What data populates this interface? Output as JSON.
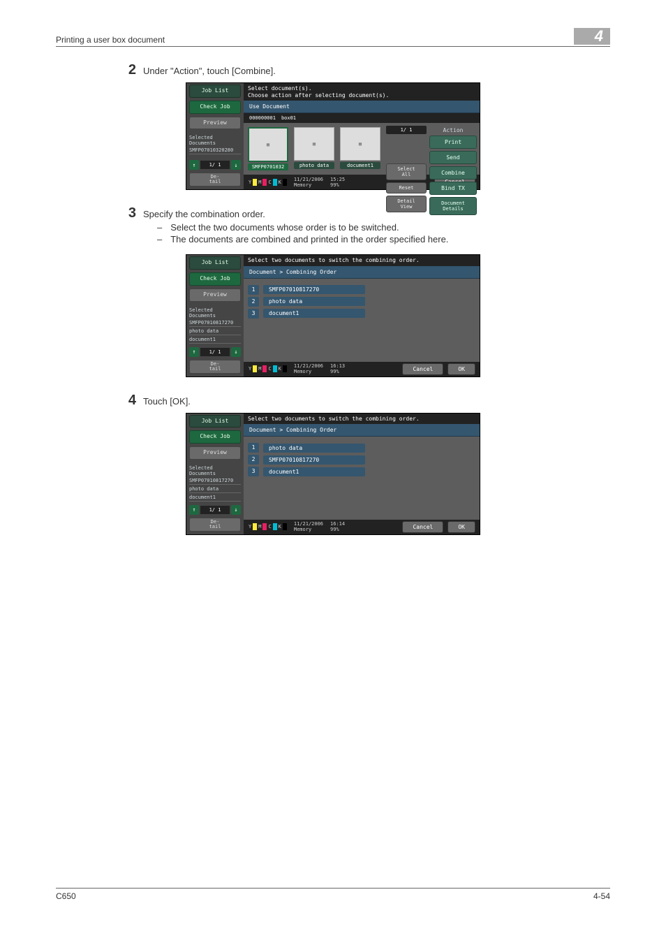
{
  "header": {
    "title": "Printing a user box document",
    "chapter": "4"
  },
  "footer": {
    "left": "C650",
    "right": "4-54"
  },
  "steps": {
    "s2": {
      "num": "2",
      "text": "Under \"Action\", touch [Combine]."
    },
    "s3": {
      "num": "3",
      "text": "Specify the combination order.",
      "subs": [
        "Select the two documents whose order is to be switched.",
        "The documents are combined and printed in the order specified here."
      ]
    },
    "s4": {
      "num": "4",
      "text": "Touch [OK]."
    }
  },
  "sc1": {
    "hint1": "Select document(s).",
    "hint2": "Choose action after selecting document(s).",
    "tab": "Use Document",
    "bar_id": "000000001",
    "bar_name": "box01",
    "side": {
      "job_list": "Job List",
      "check_job": "Check Job",
      "preview": "Preview",
      "selected": "Selected Documents",
      "items": [
        "SMFP07010320280"
      ],
      "pager": "1/  1",
      "detail": "De-\ntail"
    },
    "thumbs": [
      {
        "cap": "SMFP0701032",
        "sel": true
      },
      {
        "cap": "photo data",
        "sel": false
      },
      {
        "cap": "document1",
        "sel": false
      }
    ],
    "mid": {
      "pager": "1/  1",
      "select_all": "Select\nAll",
      "reset": "Reset",
      "detail_view": "Detail\nView"
    },
    "actions": {
      "label": "Action",
      "print": "Print",
      "send": "Send",
      "combine": "Combine",
      "bind": "Bind TX",
      "docdetails": "Document\nDetails"
    },
    "foot": {
      "date": "11/21/2006",
      "time": "15:25",
      "mem_lbl": "Memory",
      "mem": "99%",
      "cancel": "Cancel"
    }
  },
  "sc2": {
    "hint": "Select two documents to switch the combining order.",
    "crumb": "Document > Combining Order",
    "side": {
      "job_list": "Job List",
      "check_job": "Check Job",
      "preview": "Preview",
      "selected": "Selected Documents",
      "items": [
        "SMFP07010817270",
        "photo data",
        "document1"
      ],
      "pager": "1/  1",
      "detail": "De-\ntail"
    },
    "rows": [
      {
        "n": "1",
        "name": "SMFP07010817270"
      },
      {
        "n": "2",
        "name": "photo data"
      },
      {
        "n": "3",
        "name": "document1"
      }
    ],
    "foot": {
      "date": "11/21/2006",
      "time": "16:13",
      "mem_lbl": "Memory",
      "mem": "99%",
      "cancel": "Cancel",
      "ok": "OK"
    }
  },
  "sc3": {
    "hint": "Select two documents to switch the combining order.",
    "crumb": "Document > Combining Order",
    "side": {
      "job_list": "Job List",
      "check_job": "Check Job",
      "preview": "Preview",
      "selected": "Selected Documents",
      "items": [
        "SMFP07010817270",
        "photo data",
        "document1"
      ],
      "pager": "1/  1",
      "detail": "De-\ntail"
    },
    "rows": [
      {
        "n": "1",
        "name": "photo data"
      },
      {
        "n": "2",
        "name": "SMFP07010817270"
      },
      {
        "n": "3",
        "name": "document1"
      }
    ],
    "foot": {
      "date": "11/21/2006",
      "time": "16:14",
      "mem_lbl": "Memory",
      "mem": "99%",
      "cancel": "Cancel",
      "ok": "OK"
    }
  }
}
